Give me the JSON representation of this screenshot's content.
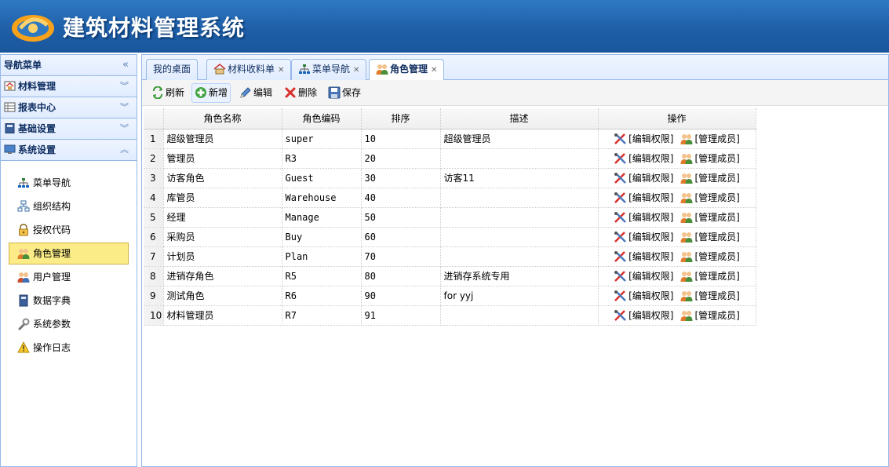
{
  "app": {
    "title": "建筑材料管理系统"
  },
  "nav": {
    "title": "导航菜单",
    "sections": [
      {
        "label": "材料管理",
        "icon": "home-icon",
        "expanded": false
      },
      {
        "label": "报表中心",
        "icon": "table-icon",
        "expanded": false
      },
      {
        "label": "基础设置",
        "icon": "book-icon",
        "expanded": false
      },
      {
        "label": "系统设置",
        "icon": "monitor-icon",
        "expanded": true
      }
    ],
    "items": [
      {
        "label": "菜单导航",
        "icon": "sitemap-icon"
      },
      {
        "label": "组织结构",
        "icon": "org-chart-icon"
      },
      {
        "label": "授权代码",
        "icon": "lock-icon"
      },
      {
        "label": "角色管理",
        "icon": "role-users-icon",
        "active": true
      },
      {
        "label": "用户管理",
        "icon": "users-icon"
      },
      {
        "label": "数据字典",
        "icon": "book-icon"
      },
      {
        "label": "系统参数",
        "icon": "wrench-icon"
      },
      {
        "label": "操作日志",
        "icon": "warning-icon"
      }
    ]
  },
  "tabs": [
    {
      "label": "我的桌面",
      "closable": false
    },
    {
      "label": "材料收料单",
      "closable": true,
      "icon": "home-icon"
    },
    {
      "label": "菜单导航",
      "closable": true,
      "icon": "sitemap-icon"
    },
    {
      "label": "角色管理",
      "closable": true,
      "icon": "role-users-icon",
      "active": true
    }
  ],
  "toolbar": {
    "refresh": "刷新",
    "add": "新增",
    "edit": "编辑",
    "delete": "删除",
    "save": "保存"
  },
  "grid": {
    "columns": [
      "角色名称",
      "角色编码",
      "排序",
      "描述",
      "操作"
    ],
    "op_edit": "[编辑权限]",
    "op_members": "[管理成员]",
    "rows": [
      {
        "n": "1",
        "name": "超级管理员",
        "code": "super",
        "sort": "10",
        "desc": "超级管理员"
      },
      {
        "n": "2",
        "name": "管理员",
        "code": "R3",
        "sort": "20",
        "desc": ""
      },
      {
        "n": "3",
        "name": "访客角色",
        "code": "Guest",
        "sort": "30",
        "desc": "访客11"
      },
      {
        "n": "4",
        "name": "库管员",
        "code": "Warehouse",
        "sort": "40",
        "desc": ""
      },
      {
        "n": "5",
        "name": "经理",
        "code": "Manage",
        "sort": "50",
        "desc": ""
      },
      {
        "n": "6",
        "name": "采购员",
        "code": "Buy",
        "sort": "60",
        "desc": ""
      },
      {
        "n": "7",
        "name": "计划员",
        "code": "Plan",
        "sort": "70",
        "desc": ""
      },
      {
        "n": "8",
        "name": "进销存角色",
        "code": "R5",
        "sort": "80",
        "desc": "进销存系统专用"
      },
      {
        "n": "9",
        "name": "测试角色",
        "code": "R6",
        "sort": "90",
        "desc": "for yyj"
      },
      {
        "n": "10",
        "name": "材料管理员",
        "code": "R7",
        "sort": "91",
        "desc": ""
      }
    ]
  }
}
